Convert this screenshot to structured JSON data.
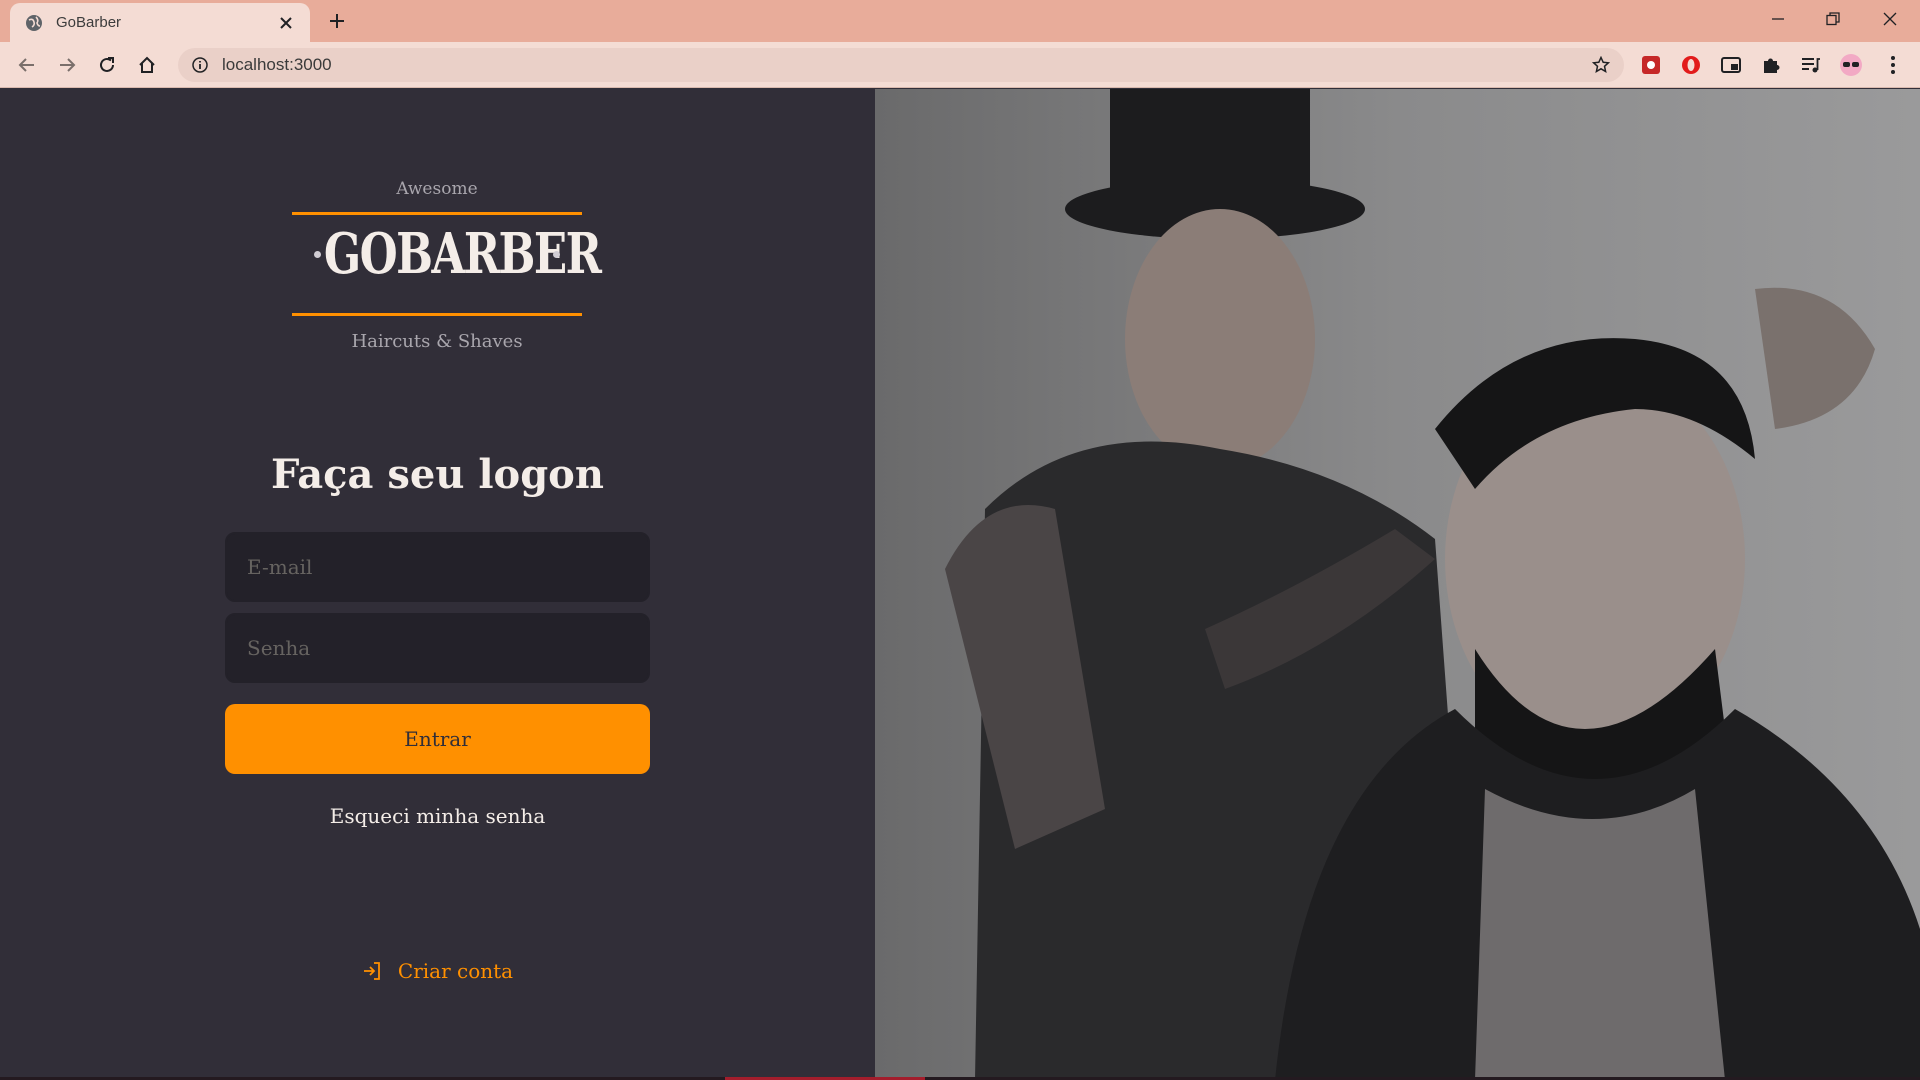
{
  "browser": {
    "tab_title": "GoBarber",
    "url": "localhost:3000"
  },
  "logo": {
    "top_text": "Awesome",
    "main_text": "GOBARBER",
    "sub_text": "Haircuts & Shaves"
  },
  "login": {
    "title": "Faça seu logon",
    "email_placeholder": "E-mail",
    "password_placeholder": "Senha",
    "submit_label": "Entrar",
    "forgot_label": "Esqueci minha senha",
    "create_account_label": "Criar conta"
  },
  "colors": {
    "background": "#312e38",
    "input_background": "#232129",
    "accent": "#ff9000",
    "text": "#f4ede8",
    "placeholder": "#666360"
  },
  "icons": {
    "create_account": "log-in-icon"
  }
}
